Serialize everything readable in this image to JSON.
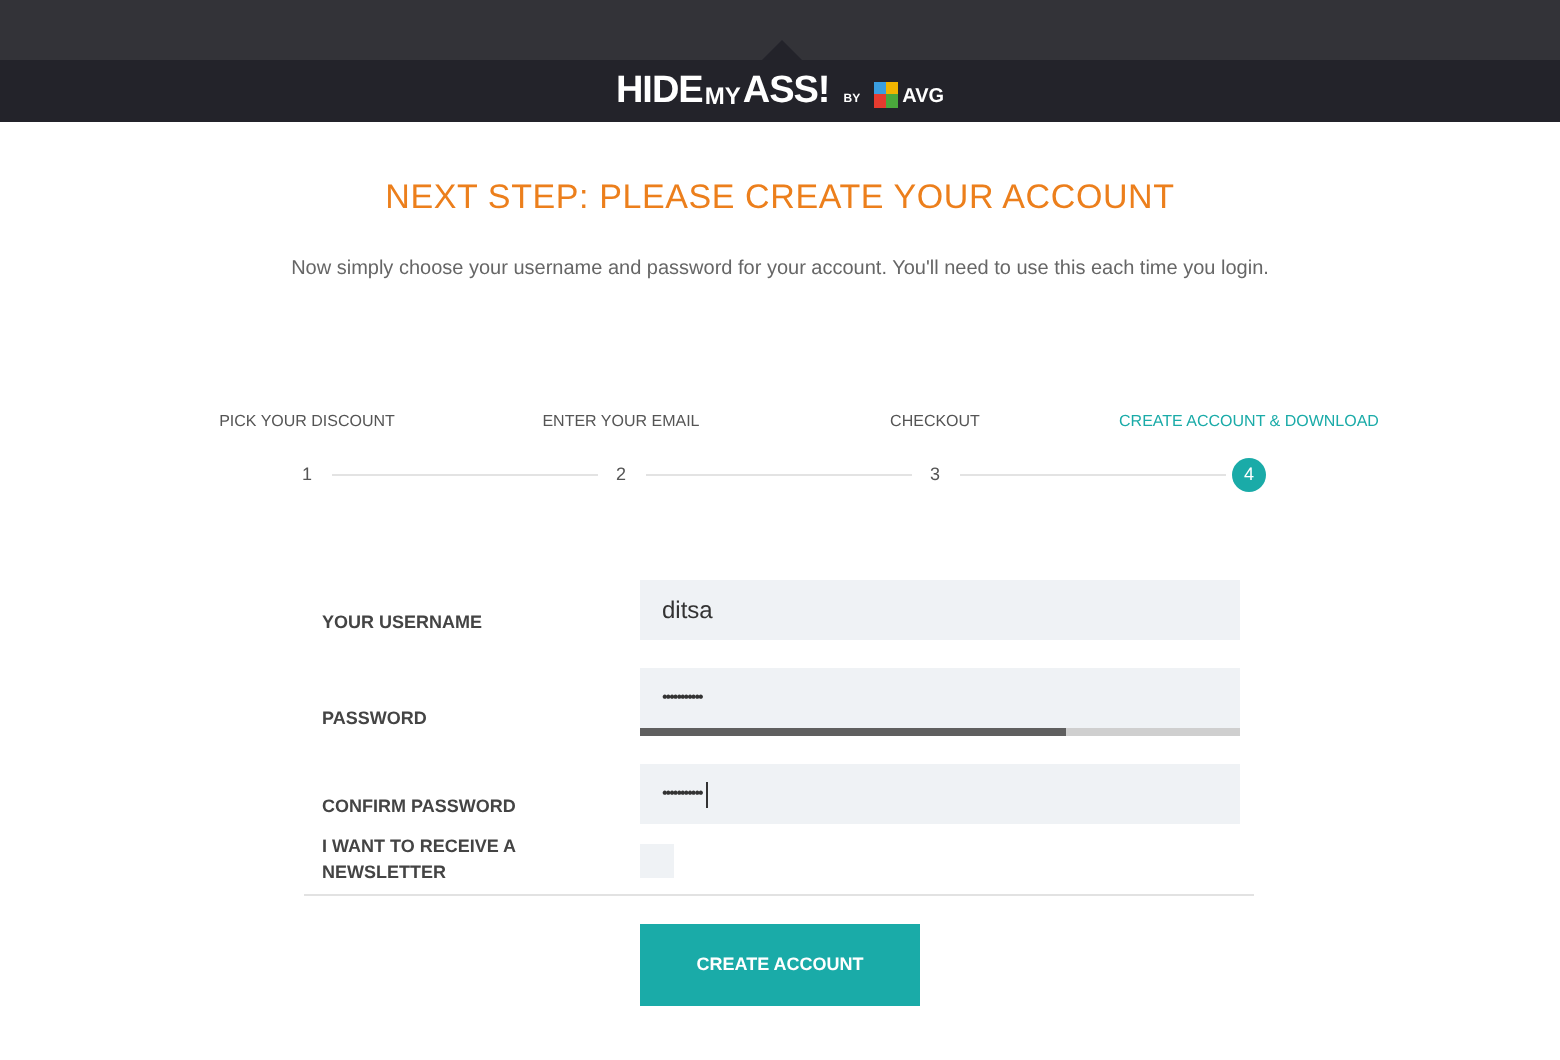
{
  "logo": {
    "parts": [
      "HIDE",
      "MY",
      "ASS!",
      "BY",
      "AVG"
    ]
  },
  "title": "NEXT STEP: PLEASE CREATE YOUR ACCOUNT",
  "intro": "Now simply choose your username and password for your account. You'll need to use this each time you login.",
  "steps": [
    {
      "label": "PICK YOUR DISCOUNT",
      "number": "1",
      "current": false
    },
    {
      "label": "ENTER YOUR EMAIL",
      "number": "2",
      "current": false
    },
    {
      "label": "CHECKOUT",
      "number": "3",
      "current": false
    },
    {
      "label": "CREATE ACCOUNT & DOWNLOAD",
      "number": "4",
      "current": true
    }
  ],
  "form": {
    "fields": [
      {
        "kind": "text",
        "label": "YOUR USERNAME",
        "value": "ditsa"
      },
      {
        "kind": "password",
        "label": "PASSWORD",
        "value": "•••••••••••",
        "strength": {
          "level": 0.71
        }
      },
      {
        "kind": "password",
        "label": "CONFIRM PASSWORD",
        "value": "•••••••••••",
        "focused": true
      },
      {
        "kind": "checkbox",
        "label": "I WANT TO RECEIVE A NEWSLETTER",
        "checked": false
      }
    ],
    "submit": "CREATE ACCOUNT"
  }
}
